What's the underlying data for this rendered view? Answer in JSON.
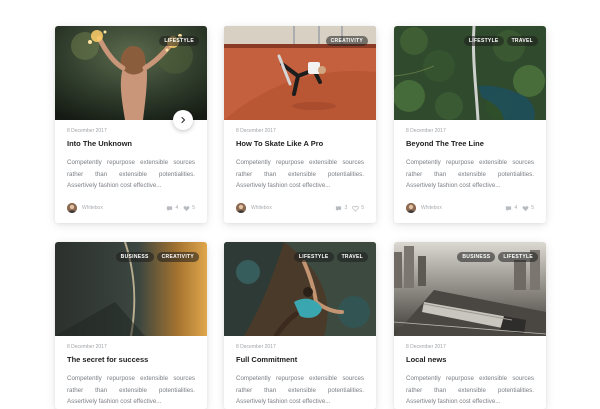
{
  "cards": [
    {
      "tags": [
        "LIFESTYLE"
      ],
      "date": "8 December 2017",
      "title": "Into The Unknown",
      "excerpt": "Competently repurpose extensible sources rather than extensible potentialities. Assertively fashion cost effective...",
      "author": "Whitebox",
      "comments": "4",
      "likes": "5",
      "image": "woman-with-sparklers-photo"
    },
    {
      "tags": [
        "CREATIVITY"
      ],
      "date": "8 December 2017",
      "title": "How To Skate Like A Pro",
      "excerpt": "Competently repurpose extensible sources rather than extensible potentialities. Assertively fashion cost effective...",
      "author": "Whitebox",
      "comments": "3",
      "likes": "5",
      "image": "skateboard-ramp-photo"
    },
    {
      "tags": [
        "LIFESTYLE",
        "TRAVEL"
      ],
      "date": "8 December 2017",
      "title": "Beyond The Tree Line",
      "excerpt": "Competently repurpose extensible sources rather than extensible potentialities. Assertively fashion cost effective...",
      "author": "Whitebox",
      "comments": "4",
      "likes": "5",
      "image": "aerial-forest-road-photo"
    },
    {
      "tags": [
        "BUSINESS",
        "CREATIVITY"
      ],
      "date": "8 December 2017",
      "title": "The secret for success",
      "excerpt": "Competently repurpose extensible sources rather than extensible potentialities. Assertively fashion cost effective...",
      "image": "curved-surface-photo"
    },
    {
      "tags": [
        "LIFESTYLE",
        "TRAVEL"
      ],
      "date": "8 December 2017",
      "title": "Full Commitment",
      "excerpt": "Competently repurpose extensible sources rather than extensible potentialities. Assertively fashion cost effective...",
      "image": "rock-climber-photo"
    },
    {
      "tags": [
        "BUSINESS",
        "LIFESTYLE"
      ],
      "date": "8 December 2017",
      "title": "Local news",
      "excerpt": "Competently repurpose extensible sources rather than extensible potentialities. Assertively fashion cost effective...",
      "image": "city-train-photo"
    }
  ],
  "icons": {
    "next": "chevron-right-icon",
    "comments": "comment-icon",
    "likes": "heart-icon"
  }
}
